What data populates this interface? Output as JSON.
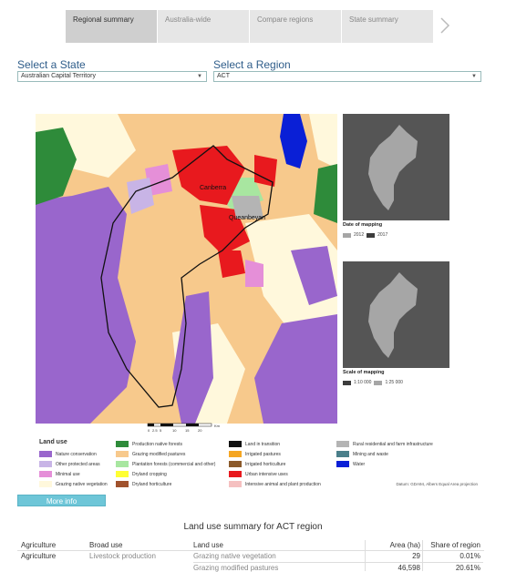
{
  "tabs": [
    {
      "label": "Regional summary",
      "active": true
    },
    {
      "label": "Australia-wide",
      "active": false
    },
    {
      "label": "Compare regions",
      "active": false
    },
    {
      "label": "State summary",
      "active": false
    }
  ],
  "next_arrow_icon": "chevron-right-icon",
  "state_select": {
    "label": "Select a State",
    "value": "Australian Capital Territory"
  },
  "region_select": {
    "label": "Select a Region",
    "value": "ACT"
  },
  "map": {
    "place_labels": [
      "Canberra",
      "Queanbeyan"
    ],
    "scale_ticks": [
      "0",
      "2.5",
      "5",
      "10",
      "15",
      "20"
    ],
    "scale_unit": "Km"
  },
  "inset_date": {
    "title": "Date of mapping",
    "legend": [
      {
        "label": "2012",
        "color": "#a6a6a6"
      },
      {
        "label": "2017",
        "color": "#3c3c3c"
      }
    ]
  },
  "inset_scale": {
    "title": "Scale of mapping",
    "legend": [
      {
        "label": "1:10 000",
        "color": "#3c3c3c"
      },
      {
        "label": "1:25 000",
        "color": "#a6a6a6"
      }
    ]
  },
  "legend": {
    "title": "Land use",
    "items": [
      {
        "label": "Nature conservation",
        "color": "#9966cc"
      },
      {
        "label": "Other protected areas",
        "color": "#c8b4e6"
      },
      {
        "label": "Minimal use",
        "color": "#e58fd8"
      },
      {
        "label": "Grazing native vegetation",
        "color": "#fff8dc"
      },
      {
        "label": "Production native forests",
        "color": "#2e8b3a"
      },
      {
        "label": "Grazing modified pastures",
        "color": "#f7c98c"
      },
      {
        "label": "Plantation forests (commercial and other)",
        "color": "#a8e6a0"
      },
      {
        "label": "Dryland cropping",
        "color": "#ffff33"
      },
      {
        "label": "Dryland horticulture",
        "color": "#a0522d"
      },
      {
        "label": "Land in transition",
        "color": "#111111"
      },
      {
        "label": "Irrigated pastures",
        "color": "#f5a623"
      },
      {
        "label": "Irrigated horticulture",
        "color": "#8b5a2b"
      },
      {
        "label": "Urban intensive uses",
        "color": "#e8191e"
      },
      {
        "label": "Intensive animal and plant production",
        "color": "#f5c0c0"
      },
      {
        "label": "Rural residential and farm infrastructure",
        "color": "#b4b4b4"
      },
      {
        "label": "Mining and waste",
        "color": "#4a7f8a"
      },
      {
        "label": "Water",
        "color": "#0a1fd6"
      }
    ],
    "datum": "Datum: GDA94, Albers Equal Area projection"
  },
  "more_info_label": "More info",
  "summary": {
    "title": "Land use summary for ACT region",
    "headers": [
      "Agriculture",
      "Broad use",
      "Land use",
      "Area (ha)",
      "Share of region"
    ],
    "rows": [
      {
        "agriculture": "Agriculture",
        "broad_use": "Livestock production",
        "land_use": "Grazing native vegetation",
        "area": "29",
        "share": "0.01%"
      },
      {
        "agriculture": "",
        "broad_use": "",
        "land_use": "Grazing modified pastures",
        "area": "46,598",
        "share": "20.61%"
      }
    ]
  }
}
